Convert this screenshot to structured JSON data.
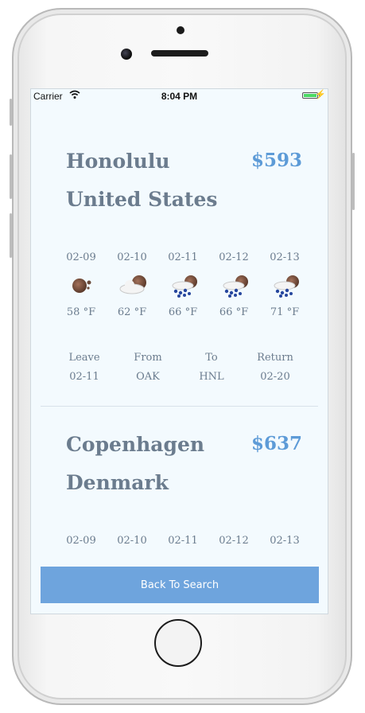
{
  "status_bar": {
    "carrier": "Carrier",
    "time": "8:04 PM"
  },
  "results": [
    {
      "city": "Honolulu",
      "country": "United States",
      "price": "$593",
      "forecast": [
        {
          "date": "02-09",
          "icon": "sunny-partly-icon",
          "temp": "58 °F"
        },
        {
          "date": "02-10",
          "icon": "partly-cloudy-icon",
          "temp": "62 °F"
        },
        {
          "date": "02-11",
          "icon": "rain-cloud-icon",
          "temp": "66 °F"
        },
        {
          "date": "02-12",
          "icon": "rain-cloud-icon",
          "temp": "66 °F"
        },
        {
          "date": "02-13",
          "icon": "rain-cloud-icon",
          "temp": "71 °F"
        }
      ],
      "trip": {
        "leave_label": "Leave",
        "leave": "02-11",
        "from_label": "From",
        "from": "OAK",
        "to_label": "To",
        "to": "HNL",
        "return_label": "Return",
        "return": "02-20"
      }
    },
    {
      "city": "Copenhagen",
      "country": "Denmark",
      "price": "$637",
      "forecast": [
        {
          "date": "02-09"
        },
        {
          "date": "02-10"
        },
        {
          "date": "02-11"
        },
        {
          "date": "02-12"
        },
        {
          "date": "02-13"
        }
      ]
    }
  ],
  "back_button": "Back To Search"
}
